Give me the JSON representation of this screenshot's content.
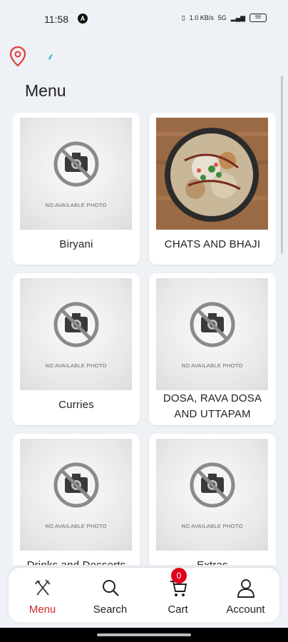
{
  "status": {
    "time": "11:58",
    "a_badge": "A",
    "network": "5G",
    "speed": "1.0 KB/s",
    "battery": "99"
  },
  "header": {
    "title": "Menu"
  },
  "no_photo_text": "NO AVAILABLE PHOTO",
  "categories": [
    {
      "label": "Biryani",
      "has_photo": false
    },
    {
      "label": "CHATS AND BHAJI",
      "has_photo": true
    },
    {
      "label": "Curries",
      "has_photo": false
    },
    {
      "label": "DOSA, RAVA DOSA AND UTTAPAM",
      "has_photo": false
    },
    {
      "label": "Drinks and Desserts",
      "has_photo": false
    },
    {
      "label": "Extras",
      "has_photo": false
    }
  ],
  "nav": {
    "menu": "Menu",
    "search": "Search",
    "cart": "Cart",
    "account": "Account",
    "cart_count": "0",
    "active_color": "#d02a2a"
  }
}
